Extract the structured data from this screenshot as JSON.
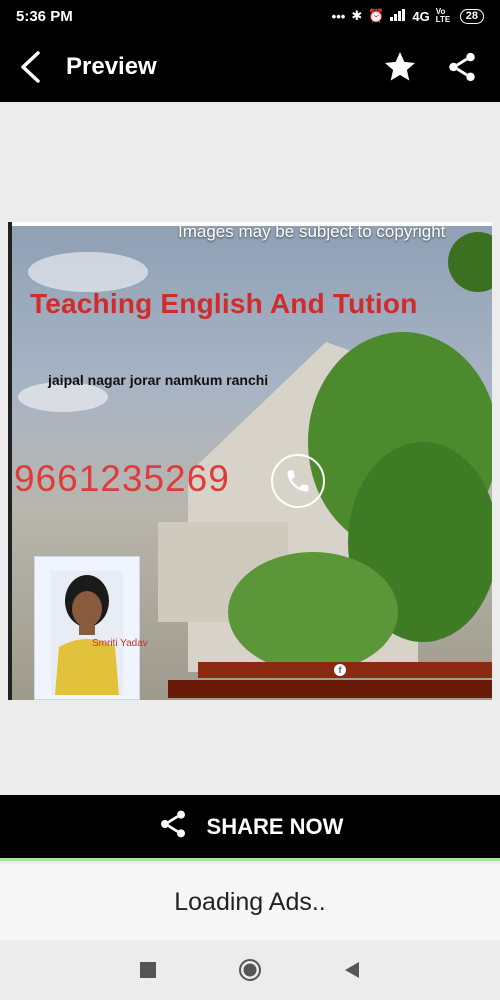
{
  "status_bar": {
    "time": "5:36 PM",
    "network": "4G",
    "volte": "Vo LTE",
    "battery": "28"
  },
  "toolbar": {
    "title": "Preview",
    "icons": [
      "back-arrow-icon",
      "star-icon",
      "share-icon"
    ]
  },
  "preview": {
    "copyright_notice": "Images may be subject to copyright",
    "headline": "Teaching English And Tution",
    "address": "jaipal nagar jorar namkum ranchi",
    "phone": "9661235269",
    "name_tag": "Smriti Yadav"
  },
  "share": {
    "label": "SHARE NOW"
  },
  "ads": {
    "loading_text": "Loading Ads.."
  },
  "colors": {
    "headline_red": "#d02c2c",
    "bar_black": "#000000",
    "share_underline": "#a7e3a0"
  }
}
